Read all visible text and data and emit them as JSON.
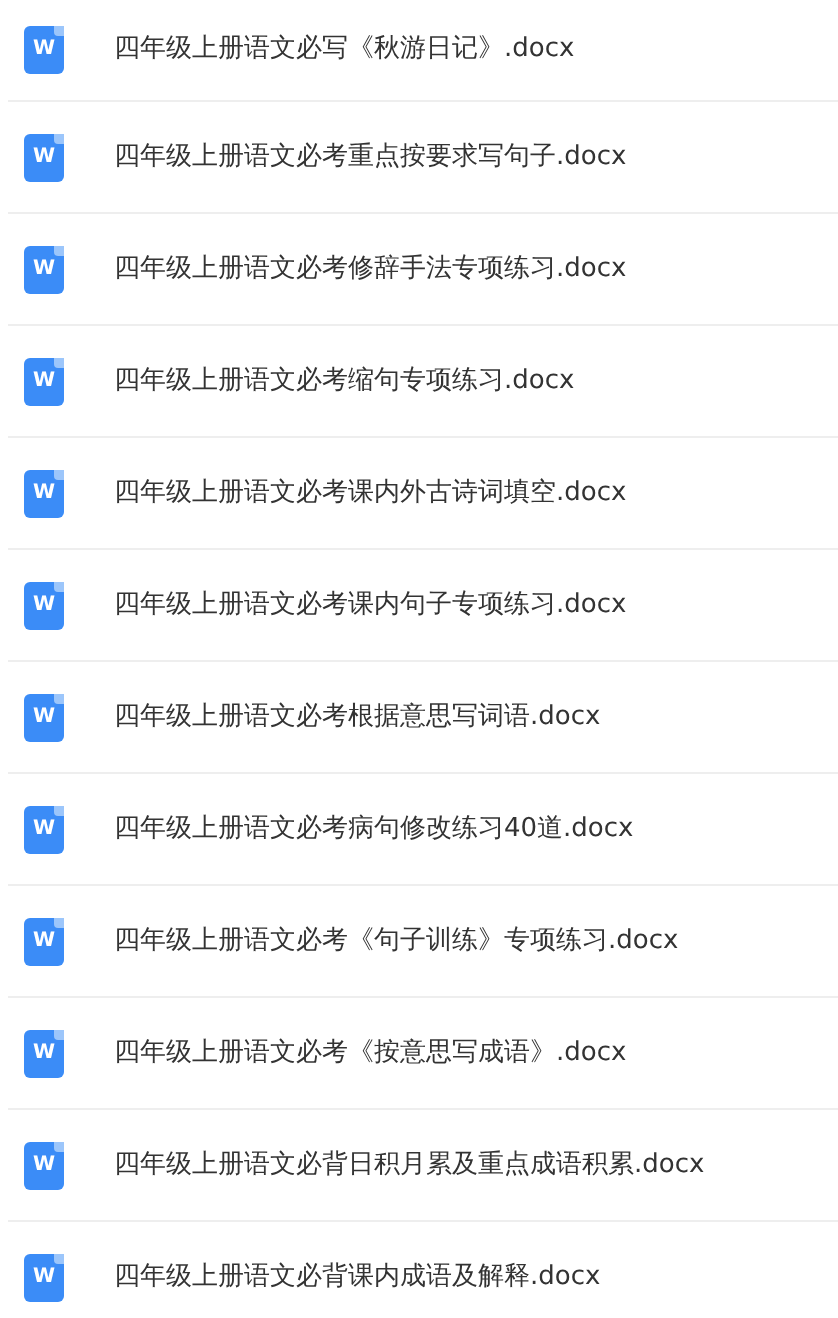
{
  "files": [
    {
      "icon_label": "W",
      "name": "四年级上册语文必写《秋游日记》.docx"
    },
    {
      "icon_label": "W",
      "name": "四年级上册语文必考重点按要求写句子.docx"
    },
    {
      "icon_label": "W",
      "name": "四年级上册语文必考修辞手法专项练习.docx"
    },
    {
      "icon_label": "W",
      "name": "四年级上册语文必考缩句专项练习.docx"
    },
    {
      "icon_label": "W",
      "name": "四年级上册语文必考课内外古诗词填空.docx"
    },
    {
      "icon_label": "W",
      "name": "四年级上册语文必考课内句子专项练习.docx"
    },
    {
      "icon_label": "W",
      "name": "四年级上册语文必考根据意思写词语.docx"
    },
    {
      "icon_label": "W",
      "name": "四年级上册语文必考病句修改练习40道.docx"
    },
    {
      "icon_label": "W",
      "name": "四年级上册语文必考《句子训练》专项练习.docx"
    },
    {
      "icon_label": "W",
      "name": "四年级上册语文必考《按意思写成语》.docx"
    },
    {
      "icon_label": "W",
      "name": "四年级上册语文必背日积月累及重点成语积累.docx"
    },
    {
      "icon_label": "W",
      "name": "四年级上册语文必背课内成语及解释.docx"
    }
  ]
}
